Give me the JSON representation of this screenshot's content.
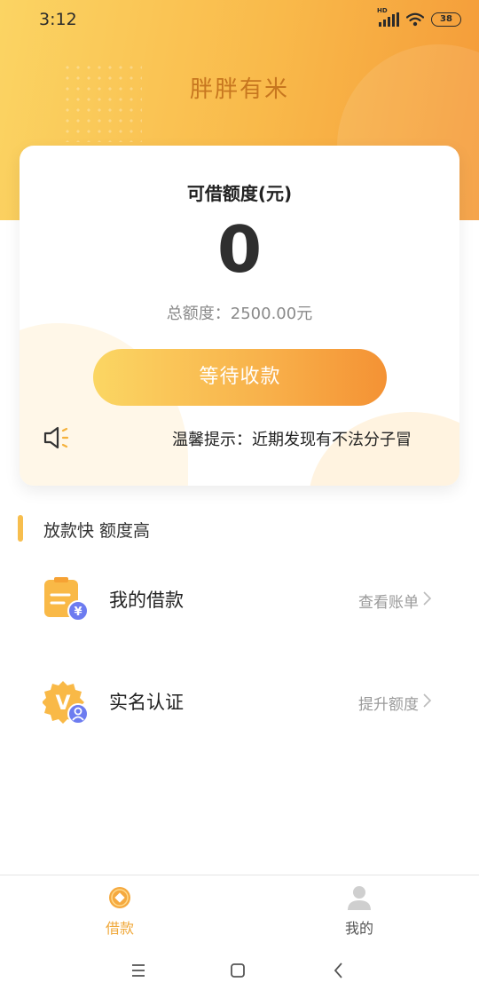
{
  "status_bar": {
    "time": "3:12",
    "battery": "38",
    "signal_badge": "HD"
  },
  "header": {
    "title": "胖胖有米"
  },
  "card": {
    "label": "可借额度(元)",
    "amount": "0",
    "total": "总额度：2500.00元",
    "button_label": "等待收款",
    "notice": "温馨提示：近期发现有不法分子冒"
  },
  "section": {
    "title": "放款快 额度高"
  },
  "list": [
    {
      "label": "我的借款",
      "action": "查看账单",
      "icon": "bill-icon"
    },
    {
      "label": "实名认证",
      "action": "提升额度",
      "icon": "verify-icon"
    }
  ],
  "bottom_nav": {
    "items": [
      {
        "label": "借款",
        "icon": "loan-icon",
        "active": true
      },
      {
        "label": "我的",
        "icon": "user-icon",
        "active": false
      }
    ]
  },
  "colors": {
    "accent": "#f5a93f",
    "active_nav": "#f0a83a",
    "inactive_nav": "#666666"
  }
}
